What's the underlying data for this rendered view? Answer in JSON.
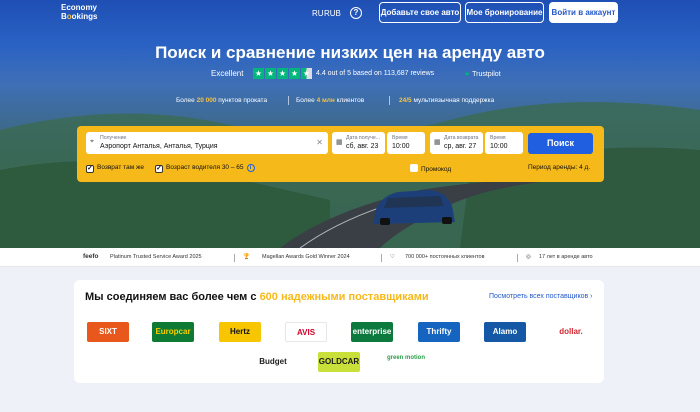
{
  "header": {
    "logo_line1": "Economy",
    "logo_line2_a": "B",
    "logo_line2_b": "o",
    "logo_line2_c": "okings",
    "lang": "RU",
    "currency": "RUB",
    "help_icon": "?",
    "add_car_label": "Добавьте свое авто",
    "my_booking_label": "Мое бронирование",
    "login_label": "Войти в аккаунт"
  },
  "hero": {
    "title": "Поиск и сравнение низких цен на аренду авто",
    "rating_label": "Excellent",
    "rating_text": "4.4 out of 5 based on 113,687 reviews",
    "trustpilot": "Trustpilot",
    "stats": [
      {
        "pre": "Более ",
        "hl": "20 000",
        "post": " пунктов проката"
      },
      {
        "pre": "Более ",
        "hl": "4 млн",
        "post": " клиентов"
      },
      {
        "pre": "",
        "hl": "24/5",
        "post": " мультиязычная поддержка"
      }
    ]
  },
  "search": {
    "pickup_label": "Получение",
    "pickup_value": "Аэропорт Анталья, Анталья, Турция",
    "pickup_date_label": "Дата получе...",
    "pickup_date_value": "сб, авг. 23",
    "pickup_time_label": "Время",
    "pickup_time_value": "10:00",
    "return_date_label": "Дата возврата",
    "return_date_value": "ср, авг. 27",
    "return_time_label": "Время",
    "return_time_value": "10:00",
    "search_button": "Поиск",
    "same_return_label": "Возврат там же",
    "same_return_checked": true,
    "driver_age_label": "Возраст водителя 30 – 65",
    "driver_age_checked": true,
    "promo_label": "Промокод",
    "promo_checked": false,
    "period_text": "Период аренды: 4 д."
  },
  "awards": {
    "feefo": "feefo",
    "feefo_award": "Platinum Trusted Service Award 2025",
    "magellan": "Magellan Awards Gold Winner 2024",
    "customers": "700 000+ постоянных клиентов",
    "years": "17 лет в аренде авто"
  },
  "suppliers": {
    "title_pre": "Мы соединяем вас более чем с ",
    "title_hl": "600 надежными поставщиками",
    "see_all": "Посмотреть всех поставщиков",
    "logos": [
      {
        "name": "SIXT",
        "bg": "#e8571b",
        "fg": "#ffffff"
      },
      {
        "name": "Europcar",
        "bg": "#0f7a33",
        "fg": "#f5d000"
      },
      {
        "name": "Hertz",
        "bg": "#f7c600",
        "fg": "#111111"
      },
      {
        "name": "AVIS",
        "bg": "#ffffff",
        "fg": "#d4002a"
      },
      {
        "name": "enterprise",
        "bg": "#0b7a3c",
        "fg": "#ffffff"
      },
      {
        "name": "Thrifty",
        "bg": "#1565c0",
        "fg": "#ffffff"
      },
      {
        "name": "Alamo",
        "bg": "#1458a6",
        "fg": "#ffffff"
      },
      {
        "name": "dollar.",
        "bg": "#ffffff",
        "fg": "#d22630"
      },
      {
        "name": "Budget",
        "bg": "#ffffff",
        "fg": "#222222"
      },
      {
        "name": "GOLDCAR",
        "bg": "#c9e03a",
        "fg": "#1b1b1b"
      },
      {
        "name": "green motion",
        "bg": "#ffffff",
        "fg": "#2a9d4a"
      }
    ]
  }
}
